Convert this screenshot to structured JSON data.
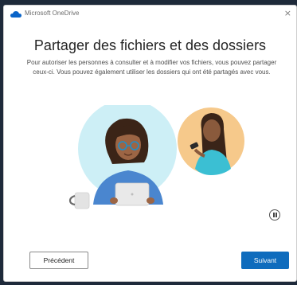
{
  "window": {
    "app_title": "Microsoft OneDrive",
    "close_glyph": "×"
  },
  "main": {
    "title": "Partager des fichiers et des dossiers",
    "description": "Pour autoriser les personnes à consulter et à modifier vos fichiers, vous pouvez partager ceux-ci. Vous pouvez également utiliser les dossiers qui ont été partagés avec vous."
  },
  "illustration": {
    "icon": "sharing-people-illustration"
  },
  "controls": {
    "pause_icon": "pause-icon",
    "prev_label": "Précédent",
    "next_label": "Suivant"
  },
  "colors": {
    "accent": "#0f6cbd",
    "circle_left": "#cdeff6",
    "circle_right": "#f6c98b"
  }
}
